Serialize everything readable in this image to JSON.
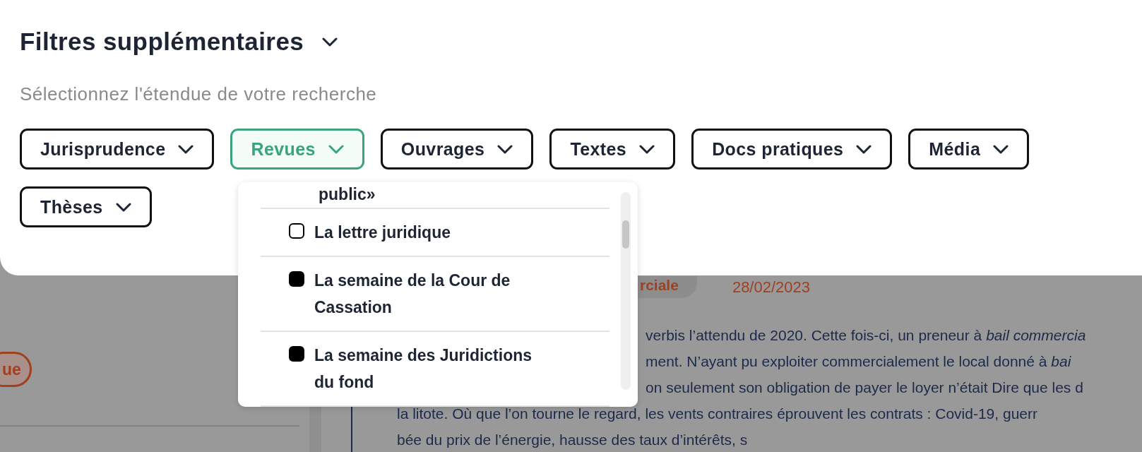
{
  "panel": {
    "title": "Filtres supplémentaires",
    "subtitle": "Sélectionnez l'étendue de votre recherche",
    "filters": [
      {
        "label": "Jurisprudence",
        "selected": false
      },
      {
        "label": "Revues",
        "selected": true
      },
      {
        "label": "Ouvrages",
        "selected": false
      },
      {
        "label": "Textes",
        "selected": false
      },
      {
        "label": "Docs pratiques",
        "selected": false
      },
      {
        "label": "Média",
        "selected": false
      },
      {
        "label": "Thèses",
        "selected": false
      }
    ]
  },
  "dropdown": {
    "cut_item_text": "public»",
    "items": [
      {
        "label": "La lettre juridique",
        "checked": false
      },
      {
        "label": "La semaine de la Cour de Cassation",
        "checked": true
      },
      {
        "label": "La semaine des Juridictions du fond",
        "checked": true
      }
    ]
  },
  "background": {
    "badge": "ue",
    "tag": "rciale",
    "date": "28/02/2023",
    "paragraph_lines": [
      "verbis l’attendu de 2020. Cette fois-ci, un preneur à *bail* *commercia*",
      "ment. N’ayant pu exploiter commercialement le local donné à *bai*",
      "on seulement son obligation de payer le loyer n’était Dire que les d",
      "la litote. Où que l’on tourne le regard, les vents contraires éprouvent les contrats : Covid-19, guerr",
      "bée du prix de l’énergie, hausse des taux d’intérêts, s"
    ]
  }
}
